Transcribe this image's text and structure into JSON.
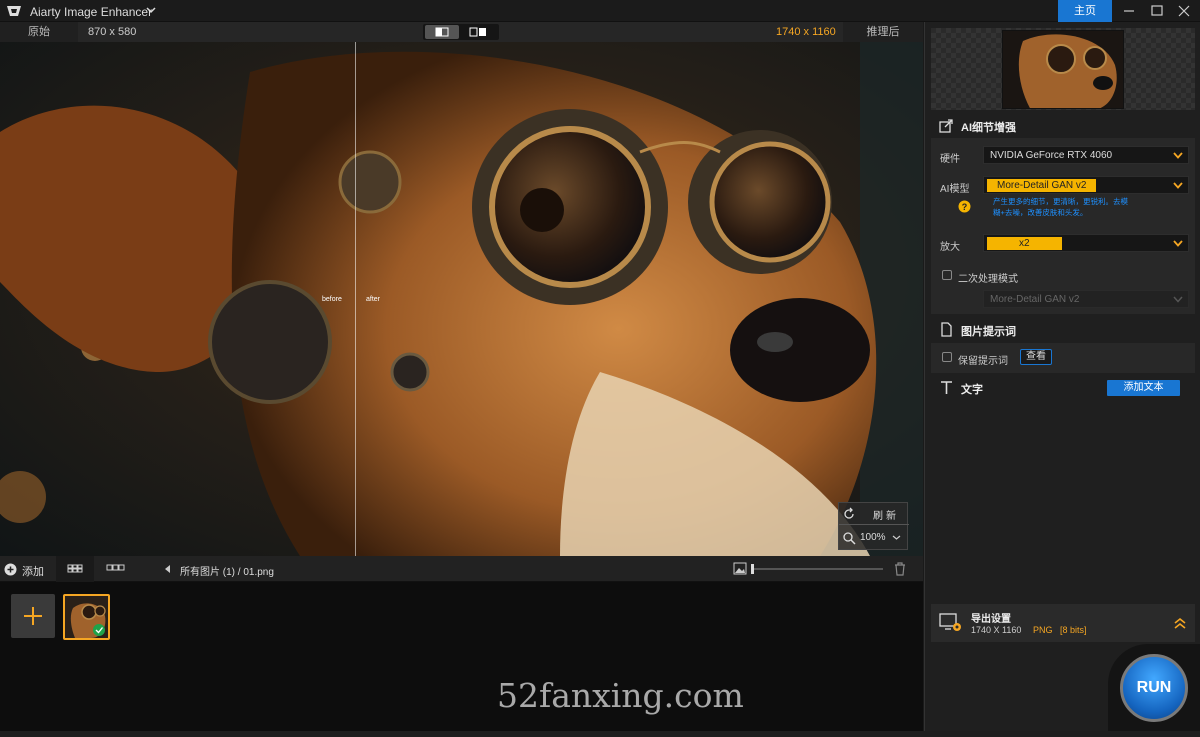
{
  "app": {
    "title": "Aiarty Image Enhancer",
    "home_label": "主页"
  },
  "infobar": {
    "original_label": "原始",
    "original_size": "870 x 580",
    "output_size": "1740 x 1160",
    "after_label": "推理后"
  },
  "viewer": {
    "before_label": "before",
    "after_label": "after",
    "refresh_label": "刷新",
    "zoom_value": "100%"
  },
  "strip": {
    "add_label": "添加",
    "breadcrumb": "所有图片 (1)  /  01.png",
    "slider_level": 0.0
  },
  "panel": {
    "ai_section_title": "AI细节增强",
    "hardware_label": "硬件",
    "hardware_value": "NVIDIA GeForce RTX 4060",
    "model_label": "AI模型",
    "model_value": "More-Detail GAN v2",
    "model_desc": "产生更多的细节，更清晰，更锐利。去模糊+去噪，改善皮肤和头发。",
    "scale_label": "放大",
    "scale_value": "x2",
    "second_pass_label": "二次处理模式",
    "second_pass_model": "More-Detail GAN v2",
    "prompt_section_title": "图片提示词",
    "keep_prompt_label": "保留提示词",
    "view_label": "查看",
    "text_section_title": "文字",
    "add_text_label": "添加文本"
  },
  "export": {
    "title": "导出设置",
    "size": "1740 X 1160",
    "format": "PNG",
    "bits": "[8 bits]"
  },
  "run_label": "RUN",
  "watermark": "52fanxing.com",
  "colors": {
    "accent_blue": "#1976d2",
    "accent_orange": "#f5a623",
    "chip_yellow": "#f5b400"
  }
}
